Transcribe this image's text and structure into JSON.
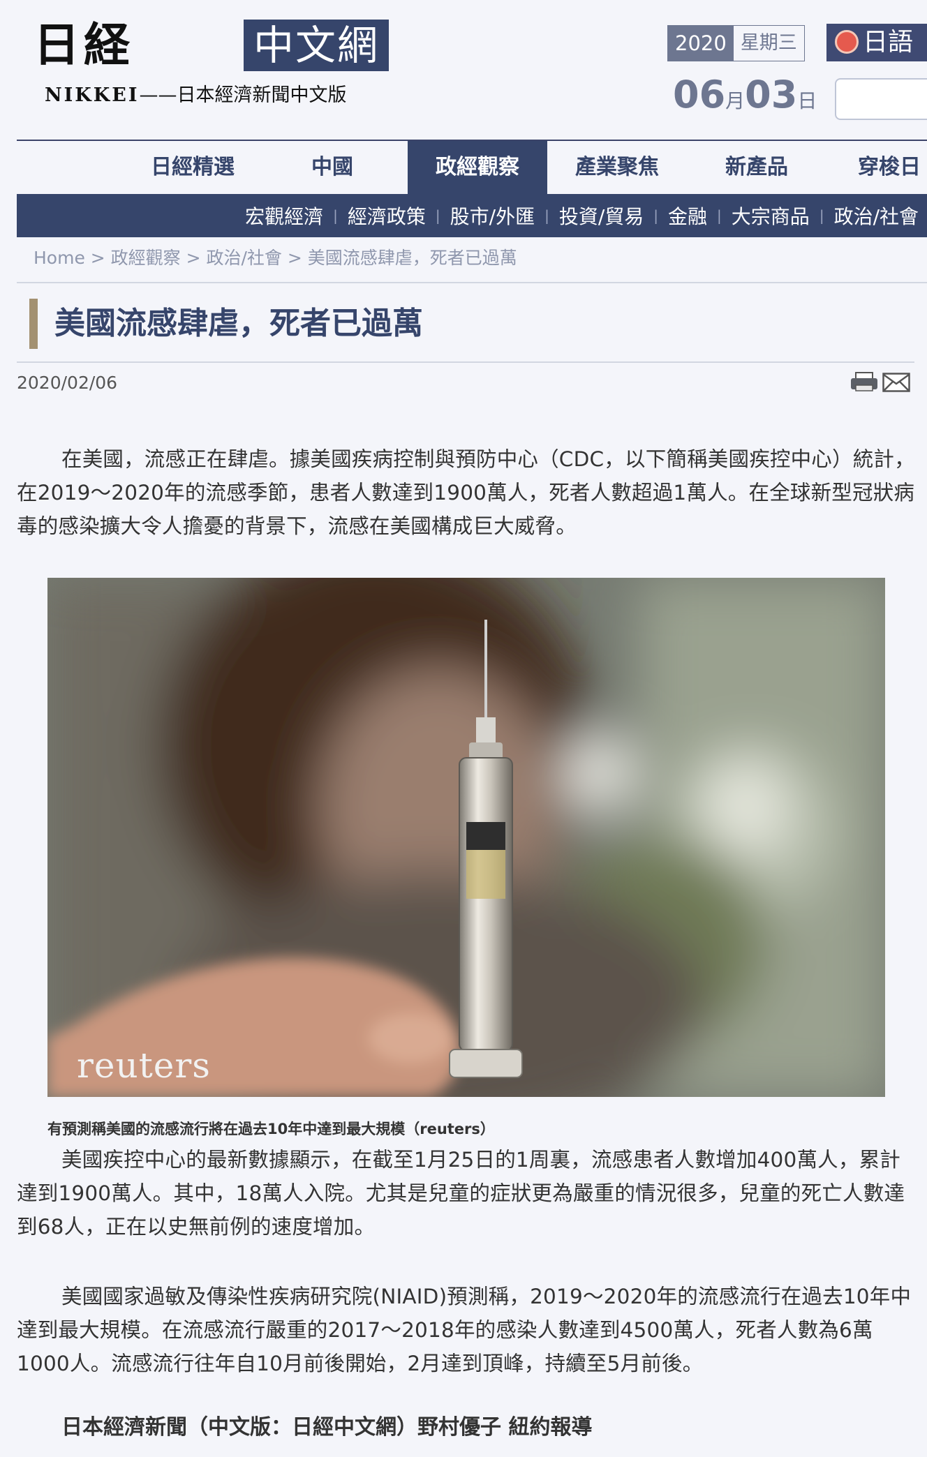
{
  "header": {
    "logo_mark": "日経",
    "logo_tag": "中文網",
    "logo_sub_brand": "NIKKEI",
    "logo_sub_text": "——日本經濟新聞中文版",
    "date_year": "2020",
    "date_weekday": "星期三",
    "date_month": "06",
    "date_month_unit": "月",
    "date_day": "03",
    "date_day_unit": "日",
    "lang_label": "日語",
    "search": {
      "value": "",
      "placeholder": ""
    }
  },
  "nav": {
    "items": [
      {
        "label": "日經精選"
      },
      {
        "label": "中國"
      },
      {
        "label": "政經觀察"
      },
      {
        "label": "產業聚焦"
      },
      {
        "label": "新產品"
      },
      {
        "label": "穿梭日"
      }
    ],
    "active_index": 2,
    "sub_items": [
      {
        "label": "宏觀經濟"
      },
      {
        "label": "經濟政策"
      },
      {
        "label": "股市/外匯"
      },
      {
        "label": "投資/貿易"
      },
      {
        "label": "金融"
      },
      {
        "label": "大宗商品"
      },
      {
        "label": "政治/社會"
      }
    ],
    "separator": "|"
  },
  "breadcrumb": {
    "text": "Home > 政經觀察 > 政治/社會 > 美國流感肆虐，死者已過萬"
  },
  "article": {
    "title": "美國流感肆虐，死者已過萬",
    "date": "2020/02/06",
    "paragraphs": [
      "在美國，流感正在肆虐。據美國疾病控制與預防中心（CDC，以下簡稱美國疾控中心）統計，在2019～2020年的流感季節，患者人數達到1900萬人，死者人數超過1萬人。在全球新型冠狀病毒的感染擴大令人擔憂的背景下，流感在美國構成巨大威脅。",
      "美國疾控中心的最新數據顯示，在截至1月25日的1周裏，流感患者人數增加400萬人，累計達到1900萬人。其中，18萬人入院。尤其是兒童的症狀更為嚴重的情況很多，兒童的死亡人數達到68人，正在以史無前例的速度增加。",
      "美國國家過敏及傳染性疾病研究院(NIAID)預測稱，2019～2020年的流感流行在過去10年中達到最大規模。在流感流行嚴重的2017～2018年的感染人數達到4500萬人，死者人數為6萬1000人。流感流行往年自10月前後開始，2月達到頂峰，持續至5月前後。"
    ],
    "photo_credit": "reuters",
    "photo_caption": "有預測稱美國的流感流行將在過去10年中達到最大規模（reuters）",
    "signature": "日本經濟新聞（中文版：日經中文網）野村優子 紐約報導"
  },
  "icons": {
    "print": "print-icon",
    "mail": "mail-icon"
  },
  "colors": {
    "brand_navy": "#36456b",
    "date_slate": "#6d7690",
    "title_accent": "#a39171",
    "background": "#f4f5fa"
  }
}
